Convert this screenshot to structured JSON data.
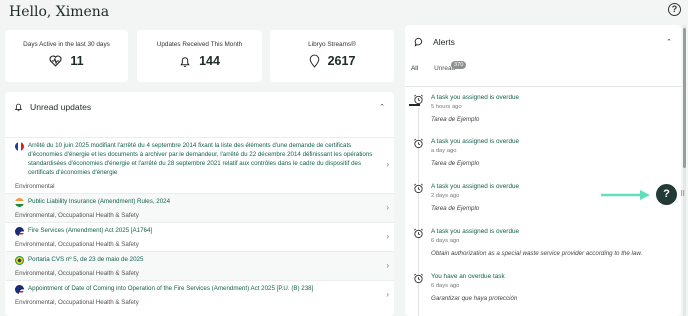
{
  "greeting": "Hello, Ximena",
  "stats": [
    {
      "label": "Days Active in the last 30 days",
      "value": "11",
      "icon": "heartbeat-icon"
    },
    {
      "label": "Updates Received This Month",
      "value": "144",
      "icon": "bell-icon"
    },
    {
      "label": "Libryo Streams®",
      "value": "2617",
      "icon": "pin-icon"
    }
  ],
  "unread": {
    "title": "Unread updates",
    "items": [
      {
        "flag": "FR",
        "title": "Arrêté du 10 juin 2025 modifiant l'arrêté du 4 septembre 2014 fixant la liste des éléments d'une demande de certificats d'économies d'énergie et les documents à archiver par le demandeur, l'arrêté du 22 décembre 2014 définissant les opérations standardisées d'économies d'énergie et l'arrêté du 28 septembre 2021 relatif aux contrôles dans le cadre du dispositif des certificats d'économies d'énergie",
        "tags": "Environmental"
      },
      {
        "flag": "IN",
        "title": "Public Liability Insurance (Amendment) Rules, 2024",
        "tags": "Environmental, Occupational Health & Safety"
      },
      {
        "flag": "MY",
        "title": "Fire Services (Amendment) Act 2025 [A1764]",
        "tags": "Environmental, Occupational Health & Safety"
      },
      {
        "flag": "BR",
        "title": "Portaria CVS nº 5, de 23 de maio de 2025",
        "tags": "Environmental, Occupational Health & Safety"
      },
      {
        "flag": "MY",
        "title": "Appointment of Date of Coming into Operation of the Fire Services (Amendment) Act 2025 [P.U. (B) 238]",
        "tags": "Environmental, Occupational Health & Safety"
      }
    ]
  },
  "alerts": {
    "title": "Alerts",
    "tabs": {
      "all": "All",
      "unread": "Unread",
      "unread_count": "370"
    },
    "items": [
      {
        "title": "A task you assigned is overdue",
        "time": "5 hours ago",
        "note": "Tarea de Ejemplo"
      },
      {
        "title": "A task you assigned is overdue",
        "time": "a day ago",
        "note": "Tarea de Ejemplo"
      },
      {
        "title": "A task you assigned is overdue",
        "time": "2 days ago",
        "note": "Tarea de Ejemplo"
      },
      {
        "title": "A task you assigned is overdue",
        "time": "6 days ago",
        "note": "Obtain authorization as a special waste service provider according to the law."
      },
      {
        "title": "You have an overdue task",
        "time": "6 days ago",
        "note": "Garantizar que haya protección"
      }
    ]
  },
  "help_fab": "?",
  "colors": {
    "accent": "#14614e",
    "fab": "#233a36",
    "arrow": "#5fe0b8"
  }
}
